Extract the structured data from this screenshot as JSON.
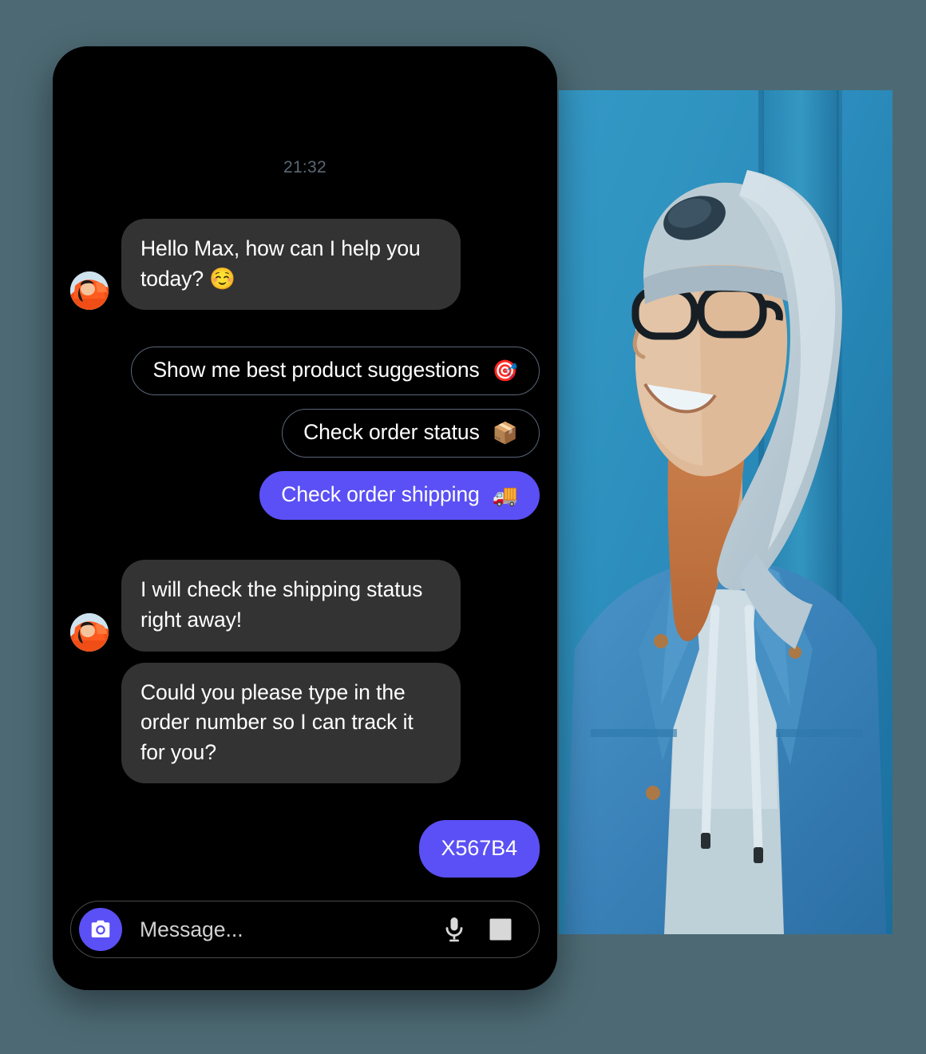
{
  "theme": {
    "page_background": "#4d6a74",
    "screen_background": "#000000",
    "bubble_background": "#333333",
    "accent_purple": "#5b50f5",
    "chip_border": "#5a6578",
    "timestamp_color": "#5b6875",
    "text_color": "#ffffff"
  },
  "chat": {
    "timestamp": "21:32",
    "bot_name": "assistant-avatar",
    "messages": [
      {
        "id": "m1",
        "sender": "bot",
        "text": "Hello Max, how can I help you today? ☺️"
      },
      {
        "id": "m2",
        "sender": "bot",
        "text": "I will check the shipping status right away!"
      },
      {
        "id": "m3",
        "sender": "bot",
        "text": "Could you please type in the order number so I can track it for you?"
      },
      {
        "id": "m4",
        "sender": "user",
        "text": "X567B4"
      }
    ],
    "quick_replies": [
      {
        "id": "q1",
        "label": "Show me best product suggestions",
        "emoji": "🎯",
        "emoji_name": "target-emoji",
        "selected": false
      },
      {
        "id": "q2",
        "label": "Check order status",
        "emoji": "📦",
        "emoji_name": "package-emoji",
        "selected": false
      },
      {
        "id": "q3",
        "label": "Check order shipping",
        "emoji": "🚚",
        "emoji_name": "truck-emoji",
        "selected": true
      }
    ]
  },
  "composer": {
    "placeholder": "Message...",
    "value": "",
    "camera_icon": "camera-icon",
    "mic_icon": "microphone-icon",
    "gallery_icon": "image-icon"
  },
  "photo": {
    "alt": "Smiling young woman wearing glasses, a grey beanie and hoodie under a denim jacket, standing in front of a blue wall"
  }
}
